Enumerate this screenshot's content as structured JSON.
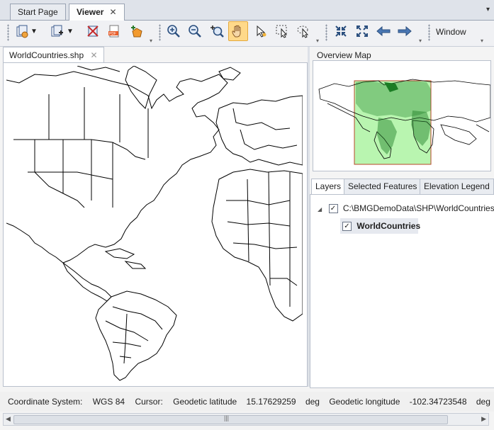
{
  "tabs": [
    {
      "label": "Start Page"
    },
    {
      "label": "Viewer",
      "close": "✕"
    }
  ],
  "tab_menu_glyph": "▾",
  "toolbar": {
    "window_label": "Window",
    "buttons": [
      "new-layer-icon",
      "add-layer-icon",
      "remove-layer-icon",
      "export-pdf-icon",
      "add-shape-icon",
      "zoom-in-icon",
      "zoom-out-icon",
      "zoom-to-icon",
      "pan-hand-icon",
      "select-icon",
      "select-box-icon",
      "select-lasso-icon",
      "full-extent-icon",
      "zoom-extent-icon",
      "back-arrow-icon",
      "forward-arrow-icon"
    ]
  },
  "map_document": {
    "tab_label": "WorldCountries.shp",
    "close": "✕"
  },
  "overview": {
    "title": "Overview Map"
  },
  "layers_panel": {
    "tabs": [
      "Layers",
      "Selected Features",
      "Elevation Legend"
    ],
    "path": "C:\\BMGDemoData\\SHP\\WorldCountries",
    "layer_name": "WorldCountries",
    "expand_glyph": "◢",
    "check_glyph": "✓"
  },
  "status": {
    "coord_label": "Coordinate System:",
    "coord_value": "WGS 84",
    "cursor_label": "Cursor:",
    "lat_label": "Geodetic latitude",
    "lat_value": "15.17629259",
    "lat_unit": "deg",
    "lon_label": "Geodetic longitude",
    "lon_value": "-102.34723548",
    "lon_unit": "deg"
  },
  "scrollbar": {
    "thumb_glyph": "|||",
    "left": "◀",
    "right": "▶"
  },
  "colors": {
    "accent_active": "#ffd98a",
    "overview_extent_fill": "#b9f5b0",
    "overview_extent_stroke": "#b8472a",
    "country_fill": "#1b7d24"
  }
}
